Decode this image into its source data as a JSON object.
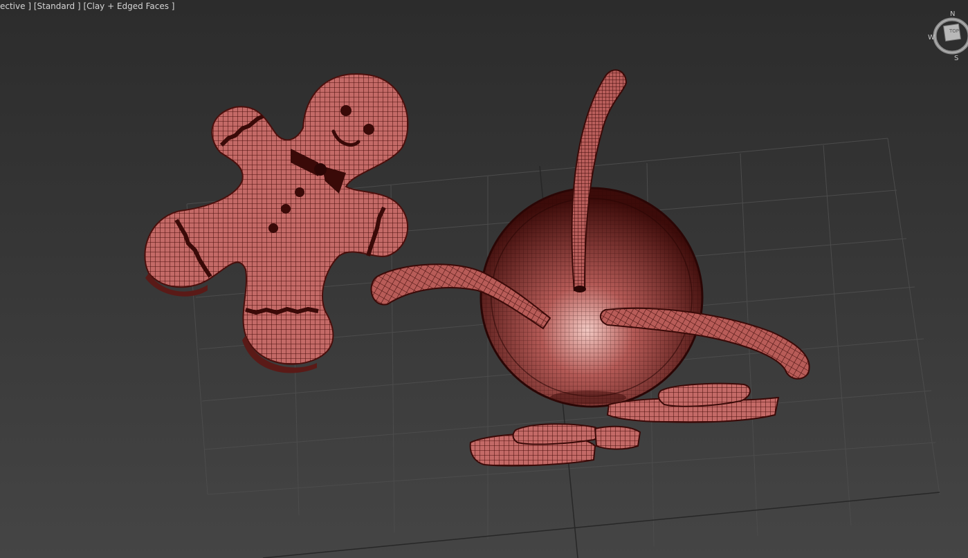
{
  "viewport": {
    "label_pov": "ective ]",
    "label_shading": "[Standard ]",
    "label_mode": "[Clay + Edged Faces ]",
    "background_top": "#2c2c2c",
    "background_bottom": "#454545",
    "grid_color": "#4e4e4e",
    "axis_color": "#262626"
  },
  "viewcube": {
    "face_label": "TOP",
    "compass_north": "N",
    "compass_west": "W",
    "compass_south": "S"
  },
  "scene": {
    "objects": [
      "gingerbread-man",
      "bowl",
      "cookie-stack"
    ],
    "clay_color": "#c96e6b",
    "wire_color": "#3a0a08"
  }
}
